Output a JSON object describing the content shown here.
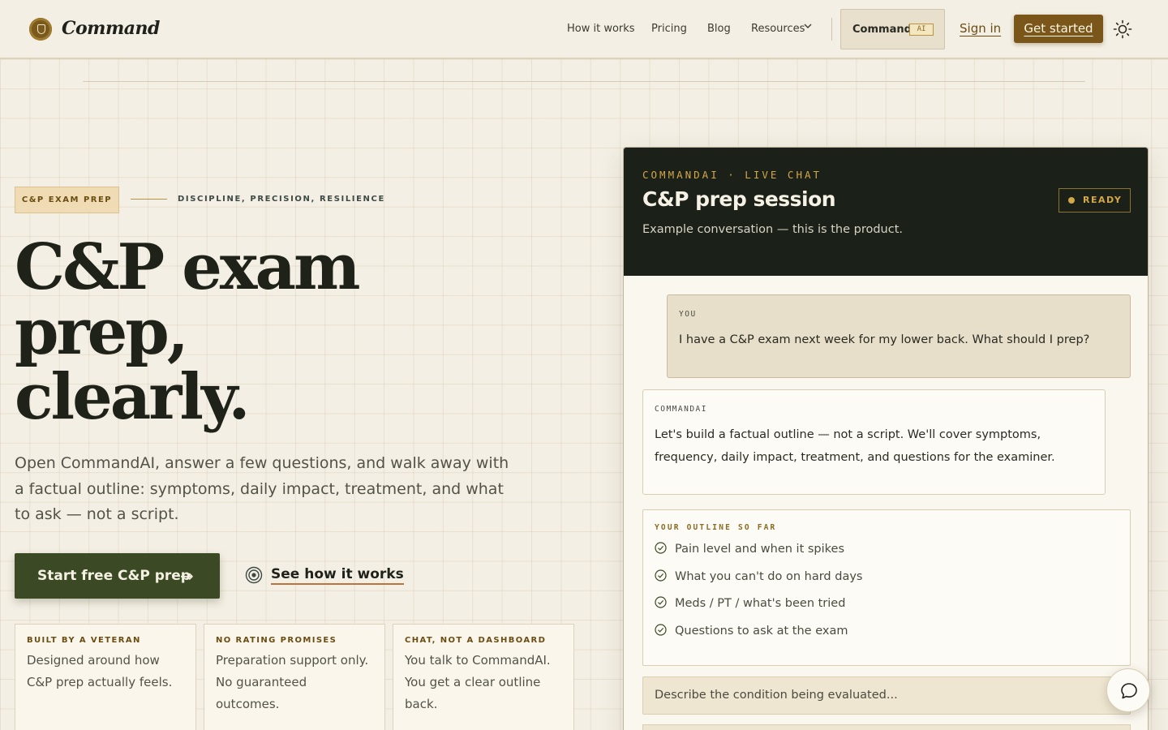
{
  "brand": {
    "name": "Command"
  },
  "nav": {
    "links": [
      "How it works",
      "Pricing",
      "Blog",
      "Resources"
    ],
    "command_label": "Command",
    "command_badge": "AI",
    "sign_in": "Sign in",
    "get_started": "Get started"
  },
  "hero": {
    "tag": "C&P EXAM PREP",
    "eyebrow": "DISCIPLINE, PRECISION, RESILIENCE",
    "title_lines": [
      "C&P exam",
      "prep,",
      "clearly."
    ],
    "subtitle": "Open CommandAI, answer a few questions, and walk away with a factual outline: symptoms, daily impact, treatment, and what to ask — not a script.",
    "cta_primary": "Start free C&P prep",
    "cta_secondary": "See how it works"
  },
  "features": [
    {
      "title": "BUILT BY A VETERAN",
      "body": "Designed around how C&P prep actually feels."
    },
    {
      "title": "NO RATING PROMISES",
      "body": "Preparation support only. No guaranteed outcomes."
    },
    {
      "title": "CHAT, NOT A DASHBOARD",
      "body": "You talk to CommandAI. You get a clear outline back."
    }
  ],
  "chat": {
    "kicker": "COMMANDAI · LIVE CHAT",
    "title": "C&P prep session",
    "description": "Example conversation — this is the product.",
    "status": "READY",
    "messages": [
      {
        "sender": "YOU",
        "text": "I have a C&P exam next week for my lower back. What should I prep?"
      },
      {
        "sender": "COMMANDAI",
        "text": "Let's build a factual outline — not a script. We'll cover symptoms, frequency, daily impact, treatment, and questions for the examiner."
      }
    ],
    "outline_label": "YOUR OUTLINE SO FAR",
    "outline_items": [
      "Pain level and when it spikes",
      "What you can't do on hard days",
      "Meds / PT / what's been tried",
      "Questions to ask at the exam"
    ],
    "input_placeholder": "Describe the condition being evaluated..."
  },
  "colors": {
    "background": "#f4efe4",
    "accent_gold": "#d3a846",
    "brand_brown": "#7a561a",
    "cta_green": "#3b4a25",
    "panel_dark": "#1b2019"
  },
  "icons": [
    "logo-shield-icon",
    "chevron-down-icon",
    "sun-icon",
    "arrow-right-icon",
    "target-icon",
    "check-circle-icon",
    "chat-bubble-icon"
  ]
}
